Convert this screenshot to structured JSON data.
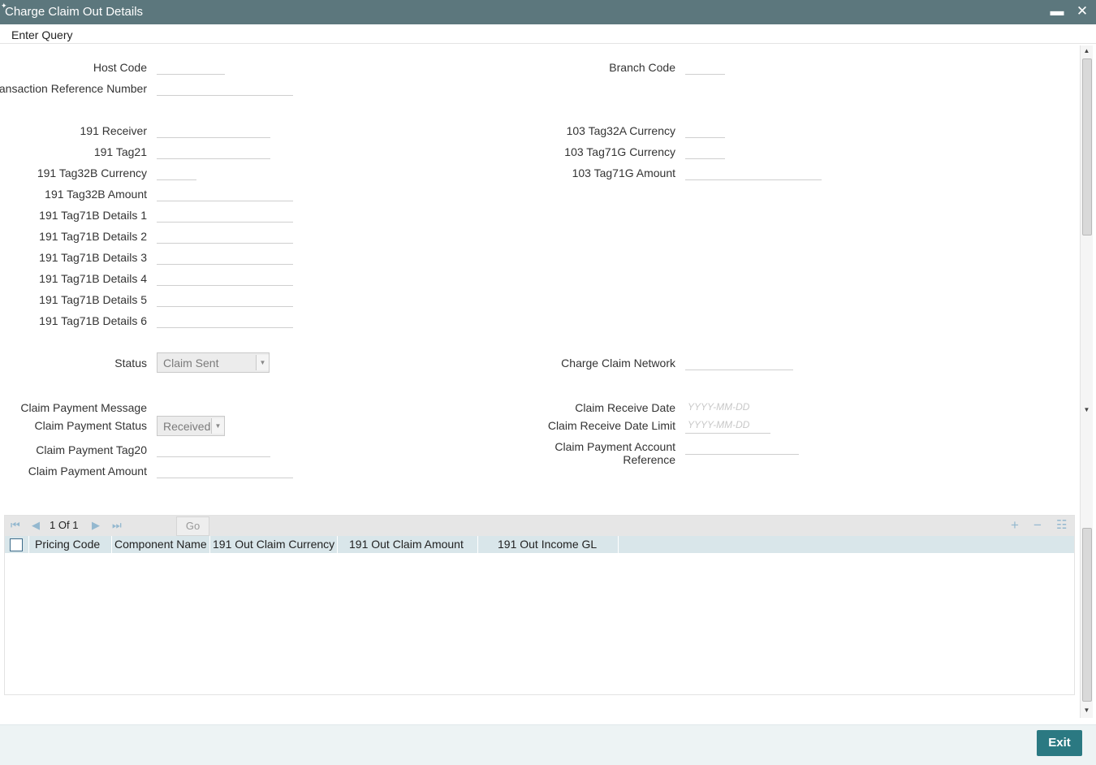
{
  "window": {
    "title": "Charge Claim Out Details",
    "minimize_icon": "minimize-icon",
    "close_icon": "close-icon",
    "minimize_glyph": "▬",
    "close_glyph": "✕",
    "corner_glyph": "✦"
  },
  "menu": {
    "enter_query": "Enter Query"
  },
  "form": {
    "host_code": {
      "label": "Host Code",
      "value": ""
    },
    "branch_code": {
      "label": "Branch Code",
      "value": ""
    },
    "transaction_reference_number": {
      "label": "Transaction Reference Number",
      "value": ""
    },
    "receiver_191": {
      "label": "191 Receiver",
      "value": ""
    },
    "tag21_191": {
      "label": "191 Tag21",
      "value": ""
    },
    "tag32b_currency_191": {
      "label": "191 Tag32B Currency",
      "value": ""
    },
    "tag32b_amount_191": {
      "label": "191 Tag32B Amount",
      "value": ""
    },
    "tag71b_details_1": {
      "label": "191 Tag71B Details 1",
      "value": ""
    },
    "tag71b_details_2": {
      "label": "191 Tag71B Details 2",
      "value": ""
    },
    "tag71b_details_3": {
      "label": "191 Tag71B Details 3",
      "value": ""
    },
    "tag71b_details_4": {
      "label": "191 Tag71B Details 4",
      "value": ""
    },
    "tag71b_details_5": {
      "label": "191 Tag71B Details 5",
      "value": ""
    },
    "tag71b_details_6": {
      "label": "191 Tag71B Details 6",
      "value": ""
    },
    "tag32a_currency_103": {
      "label": "103 Tag32A Currency",
      "value": ""
    },
    "tag71g_currency_103": {
      "label": "103 Tag71G Currency",
      "value": ""
    },
    "tag71g_amount_103": {
      "label": "103 Tag71G Amount",
      "value": ""
    },
    "status": {
      "label": "Status",
      "value": "Claim Sent"
    },
    "charge_claim_network": {
      "label": "Charge Claim Network",
      "value": ""
    },
    "claim_payment_message": {
      "label": "Claim Payment Message"
    },
    "claim_payment_status": {
      "label": "Claim Payment Status",
      "value": "Received"
    },
    "claim_payment_tag20": {
      "label": "Claim Payment Tag20",
      "value": ""
    },
    "claim_payment_amount": {
      "label": "Claim Payment Amount",
      "value": ""
    },
    "claim_receive_date": {
      "label": "Claim Receive Date",
      "placeholder": "YYYY-MM-DD",
      "value": ""
    },
    "claim_receive_date_limit": {
      "label": "Claim Receive Date Limit",
      "placeholder": "YYYY-MM-DD",
      "value": ""
    },
    "claim_payment_account_reference": {
      "label_line1": "Claim Payment Account",
      "label_line2": "Reference",
      "value": ""
    }
  },
  "grid": {
    "page_current": "1",
    "page_of": "Of",
    "page_total": "1",
    "go_label": "Go",
    "columns": [
      "Pricing Code",
      "Component Name",
      "191 Out Claim Currency",
      "191 Out Claim Amount",
      "191 Out Income GL"
    ],
    "rows": [],
    "nav_icons": [
      "first-page-icon",
      "previous-page-icon",
      "next-page-icon",
      "last-page-icon"
    ],
    "nav_glyphs": [
      "⏮",
      "◀",
      "▶",
      "⏭"
    ],
    "tool_glyphs": [
      "+",
      "−",
      "☷"
    ]
  },
  "footer": {
    "exit_label": "Exit"
  },
  "colors": {
    "titlebar": "#5c777d",
    "exit_button": "#2b7982",
    "grid_header": "#d9e6ea",
    "footer": "#edf3f4"
  }
}
